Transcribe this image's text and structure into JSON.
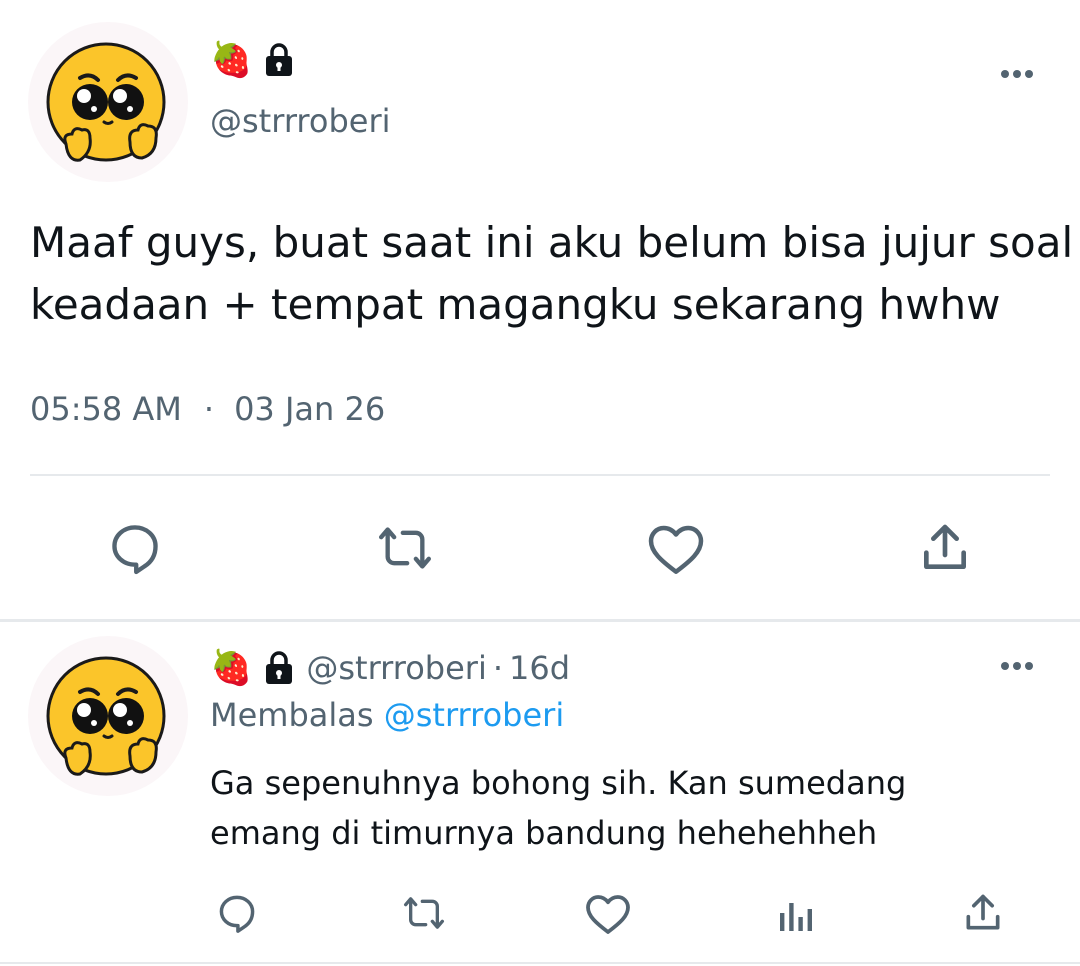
{
  "main_tweet": {
    "emoji": "🍓",
    "handle": "@strrroberi",
    "text_line1": "Maaf guys, buat saat ini aku belum bisa jujur soal",
    "text_line2": "keadaan + tempat magangku sekarang hwhw",
    "time": "05:58 AM",
    "separator": "·",
    "date": "03 Jan 26"
  },
  "reply_tweet": {
    "emoji": "🍓",
    "handle": "@strrroberi",
    "dot": "·",
    "age": "16d",
    "replying_prefix": "Membalas",
    "replying_to": "@strrroberi",
    "text_line1": "Ga sepenuhnya bohong sih. Kan sumedang",
    "text_line2": "emang di timurnya bandung hehehehheh"
  },
  "icons": {
    "lock": "lock-icon",
    "more": "more-icon",
    "reply": "reply-icon",
    "retweet": "retweet-icon",
    "like": "like-icon",
    "share": "share-icon",
    "analytics": "analytics-icon"
  },
  "colors": {
    "text": "#0f1419",
    "secondary": "#536471",
    "link": "#1d9bf0",
    "icon": "#536471",
    "divider": "#e6e9ec"
  }
}
